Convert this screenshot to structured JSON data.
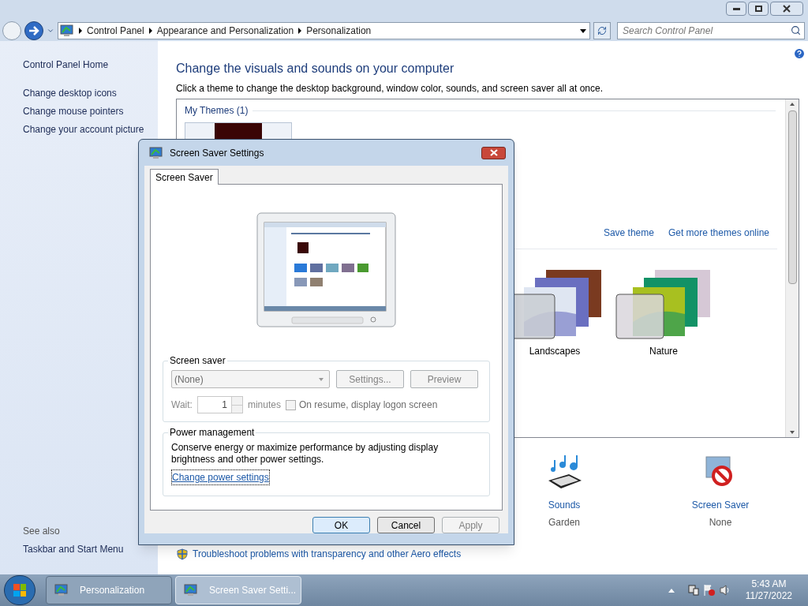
{
  "address_bar": {
    "breadcrumbs": [
      "Control Panel",
      "Appearance and Personalization",
      "Personalization"
    ],
    "search_placeholder": "Search Control Panel"
  },
  "sidebar": {
    "items": [
      "Control Panel Home",
      "Change desktop icons",
      "Change mouse pointers",
      "Change your account picture"
    ],
    "see_also_label": "See also",
    "see_also_items": [
      "Taskbar and Start Menu"
    ]
  },
  "main": {
    "heading": "Change the visuals and sounds on your computer",
    "description": "Click a theme to change the desktop background, window color, sounds, and screen saver all at once.",
    "group_label": "My Themes (1)",
    "links": [
      "Save theme",
      "Get more themes online"
    ],
    "themes": [
      {
        "name": "Landscapes",
        "kind": "landscapes"
      },
      {
        "name": "Nature",
        "kind": "nature"
      }
    ],
    "settings": [
      {
        "label": "Sounds",
        "value": "Garden",
        "kind": "sounds"
      },
      {
        "label": "Screen Saver",
        "value": "None",
        "kind": "screensaver"
      }
    ],
    "troubleshoot_link": "Troubleshoot problems with transparency and other Aero effects"
  },
  "dialog": {
    "title": "Screen Saver Settings",
    "tabs": [
      {
        "label": "Screen Saver",
        "selected": true
      }
    ],
    "screen_saver": {
      "label": "Screen saver",
      "value": "(None)",
      "buttons": [
        {
          "label": "Settings...",
          "disabled": true
        },
        {
          "label": "Preview",
          "disabled": true
        }
      ],
      "wait_label": "Wait:",
      "wait_value": "1",
      "unit": "minutes",
      "checkbox": {
        "label": "On resume, display logon screen",
        "checked": false,
        "disabled": true
      }
    },
    "power": {
      "label": "Power management",
      "text": "Conserve energy or maximize performance by adjusting display brightness and other power settings.",
      "link": "Change power settings"
    },
    "buttons": [
      {
        "label": "OK",
        "default": true,
        "disabled": false
      },
      {
        "label": "Cancel",
        "default": false,
        "disabled": false
      },
      {
        "label": "Apply",
        "default": false,
        "disabled": true
      }
    ]
  },
  "taskbar": {
    "items": [
      {
        "label": "Personalization",
        "selected": false
      },
      {
        "label": "Screen Saver Setti...",
        "selected": true
      }
    ],
    "time": "5:43 AM",
    "date": "11/27/2022"
  }
}
